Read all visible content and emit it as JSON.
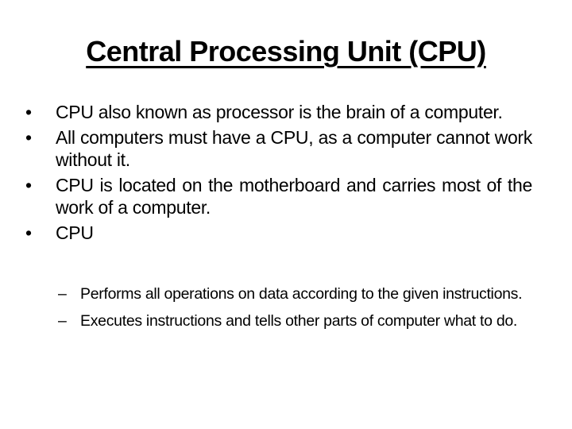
{
  "slide": {
    "title": "Central Processing Unit (CPU)",
    "bullet_glyph": "•",
    "sub_glyph": "–",
    "bullets": [
      "CPU also known as processor is the brain of a computer.",
      "All computers must have a CPU, as a computer cannot work without it.",
      "CPU is located on the motherboard and carries most of the work of a computer.",
      "CPU"
    ],
    "sub_bullets": [
      "Performs all operations on data according to the given instructions.",
      "Executes instructions and tells other parts of computer what to do."
    ]
  }
}
